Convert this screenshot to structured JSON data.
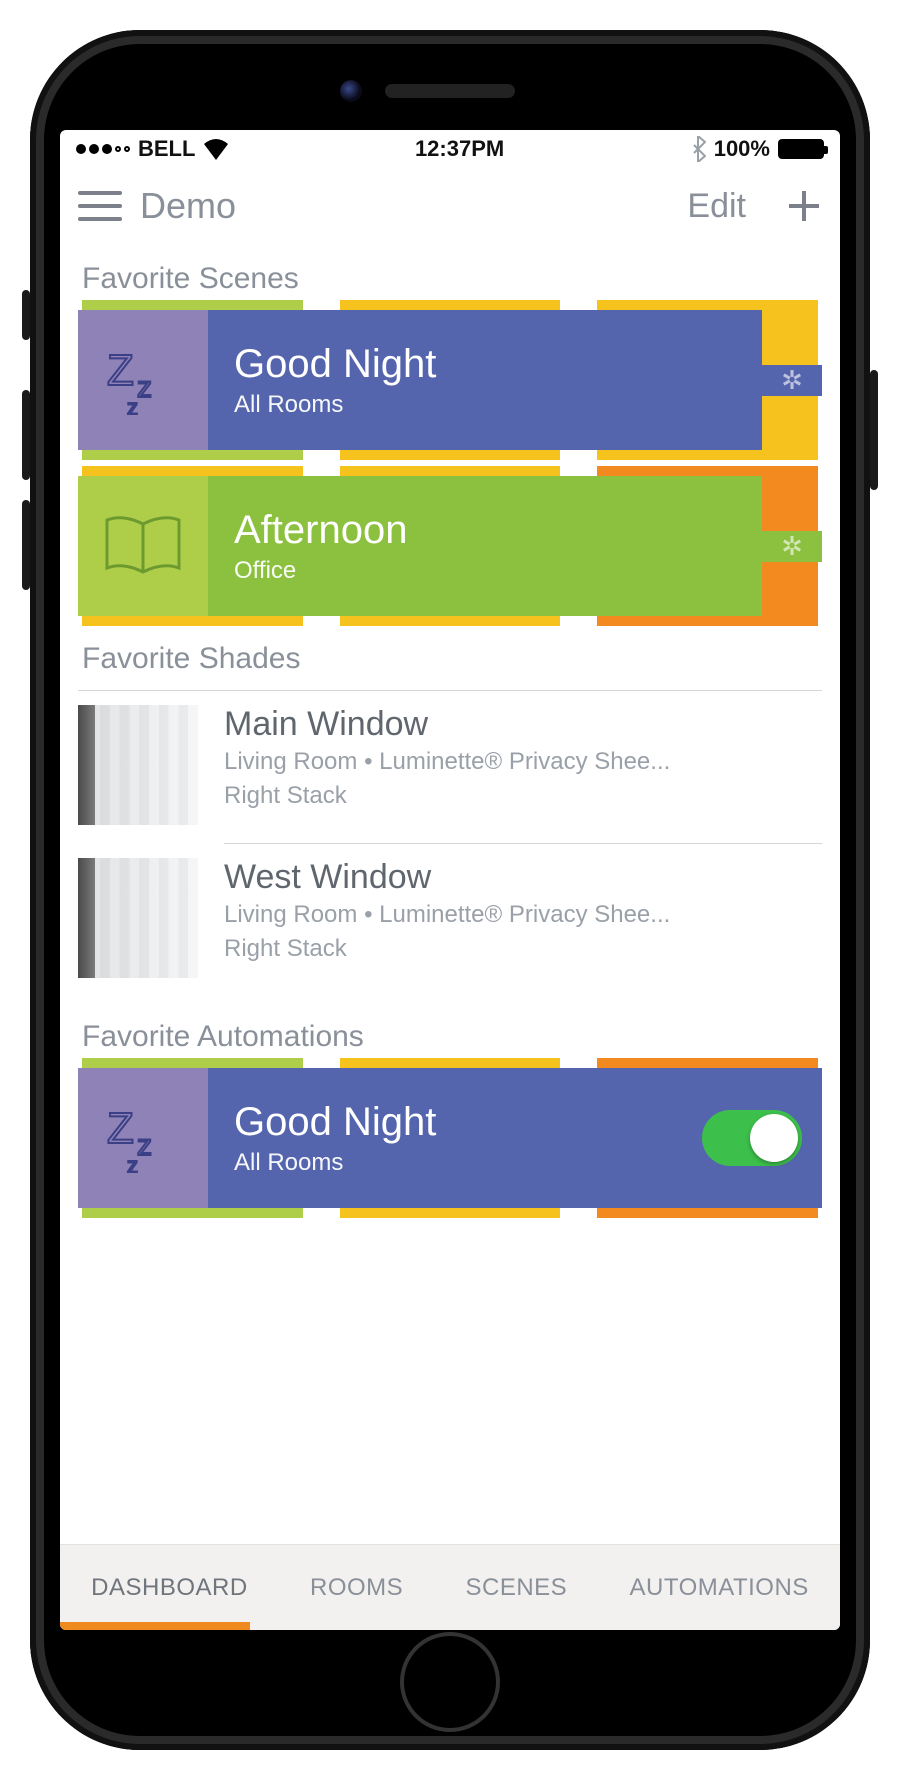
{
  "statusbar": {
    "carrier": "BELL",
    "time": "12:37PM",
    "battery_pct": "100%"
  },
  "navbar": {
    "title": "Demo",
    "edit_label": "Edit"
  },
  "sections": {
    "scenes_title": "Favorite Scenes",
    "shades_title": "Favorite Shades",
    "automations_title": "Favorite Automations"
  },
  "scenes": [
    {
      "name": "Good Night",
      "subtitle": "All Rooms",
      "icon": "sleep-zz",
      "icon_bg": "#8f82b6",
      "body_bg": "#5565ad",
      "back_left": "#aece4a",
      "back_mid": "#f5c21e",
      "back_right": "#f5c21e"
    },
    {
      "name": "Afternoon",
      "subtitle": "Office",
      "icon": "book-open",
      "icon_bg": "#aece4a",
      "body_bg": "#8cc03f",
      "back_left": "#f5c21e",
      "back_mid": "#f5c21e",
      "back_right": "#f28a1f"
    }
  ],
  "shades": [
    {
      "name": "Main Window",
      "detail_line1": "Living Room • Luminette® Privacy Shee...",
      "detail_line2": "Right Stack"
    },
    {
      "name": "West Window",
      "detail_line1": "Living Room • Luminette® Privacy Shee...",
      "detail_line2": "Right Stack"
    }
  ],
  "automations": [
    {
      "name": "Good Night",
      "subtitle": "All Rooms",
      "icon": "sleep-zz",
      "icon_bg": "#8f82b6",
      "body_bg": "#5565ad",
      "toggle_on": true,
      "back_left": "#aece4a",
      "back_mid": "#f5c21e",
      "back_right": "#f28a1f"
    }
  ],
  "tabs": {
    "items": [
      "DASHBOARD",
      "ROOMS",
      "SCENES",
      "AUTOMATIONS"
    ],
    "active_index": 0,
    "indicator_color": "#ef8a1f"
  }
}
